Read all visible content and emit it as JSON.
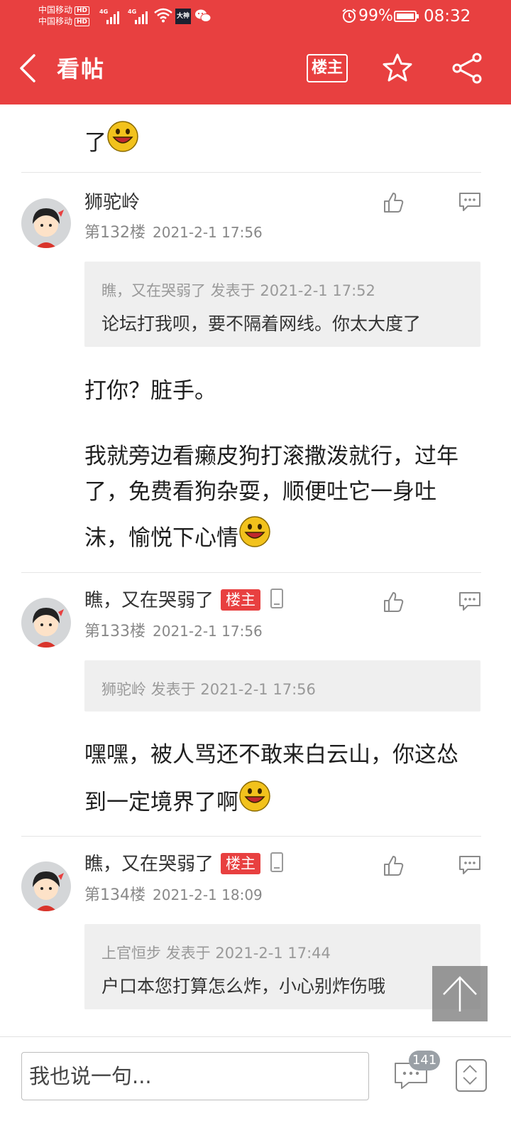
{
  "status_bar": {
    "carrier_1": "中国移动",
    "carrier_2": "中国移动",
    "hd": "HD",
    "net_type": "4G",
    "app_badge": "大神",
    "battery_pct": "99%",
    "battery_level": 0.99,
    "time": "08:32"
  },
  "header": {
    "title": "看帖",
    "op_filter_label": "楼主",
    "icons": [
      "back-icon",
      "star-icon",
      "share-icon"
    ]
  },
  "top_partial": {
    "text": "了"
  },
  "posts": [
    {
      "author": "狮驼岭",
      "is_op": false,
      "floor": "第132楼",
      "datetime": "2021-2-1 17:56",
      "quote": {
        "meta": "瞧，又在哭弱了 发表于 2021-2-1 17:52",
        "text": "论坛打我呗，要不隔着网线。你太大度了"
      },
      "body_line_1": "打你？脏手。",
      "body_line_2": "我就旁边看癞皮狗打滚撒泼就行，过年",
      "body_line_3": "了，免费看狗杂耍，顺便吐它一身吐",
      "body_line_4": "沫，愉悦下心情"
    },
    {
      "author": "瞧，又在哭弱了",
      "is_op": true,
      "op_tag": "楼主",
      "floor": "第133楼",
      "datetime": "2021-2-1 17:56",
      "quote": {
        "meta": "狮驼岭 发表于 2021-2-1 17:56",
        "text": ""
      },
      "body_line_1": "嘿嘿，被人骂还不敢来白云山，你这怂",
      "body_line_2": "到一定境界了啊"
    },
    {
      "author": "瞧，又在哭弱了",
      "is_op": true,
      "op_tag": "楼主",
      "floor": "第134楼",
      "datetime": "2021-2-1 18:09",
      "quote": {
        "meta": "上官恒步 发表于 2021-2-1 17:44",
        "text": "户口本您打算怎么炸，小心别炸伤哦"
      }
    }
  ],
  "bottom_bar": {
    "input_placeholder": "我也说一句...",
    "comment_count": "141"
  },
  "colors": {
    "brand_red": "#e84040",
    "quote_bg": "#efefef",
    "muted_text": "#888888"
  }
}
